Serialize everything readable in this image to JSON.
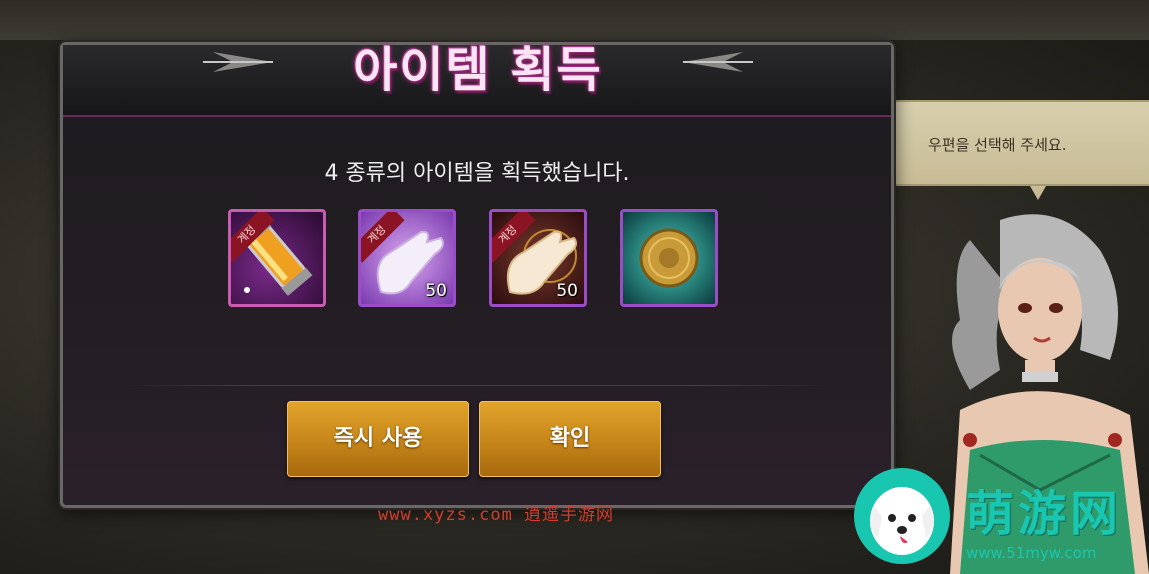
{
  "dialog": {
    "title": "아이템 획득",
    "message": "4 종류의 아이템을 획득했습니다.",
    "items": [
      {
        "icon": "potion-tube-icon",
        "tag": "계정",
        "quantity": ""
      },
      {
        "icon": "white-glove-icon",
        "tag": "계정",
        "quantity": "50"
      },
      {
        "icon": "golden-glove-icon",
        "tag": "계정",
        "quantity": "50"
      },
      {
        "icon": "gold-coin-icon",
        "tag": "",
        "quantity": ""
      }
    ],
    "buttons": {
      "use_now": "즉시 사용",
      "confirm": "확인"
    }
  },
  "npc": {
    "speech": "우편을 선택해 주세요."
  },
  "watermark": {
    "site": "www.xyzs.com 逍遥手游网",
    "brand": "萌游网",
    "brand_url": "www.51myw.com"
  },
  "colors": {
    "button": "#c8881a",
    "item_border": "#9b4cc7",
    "title_glow": "#b0368e",
    "brand": "#19c7b0"
  }
}
